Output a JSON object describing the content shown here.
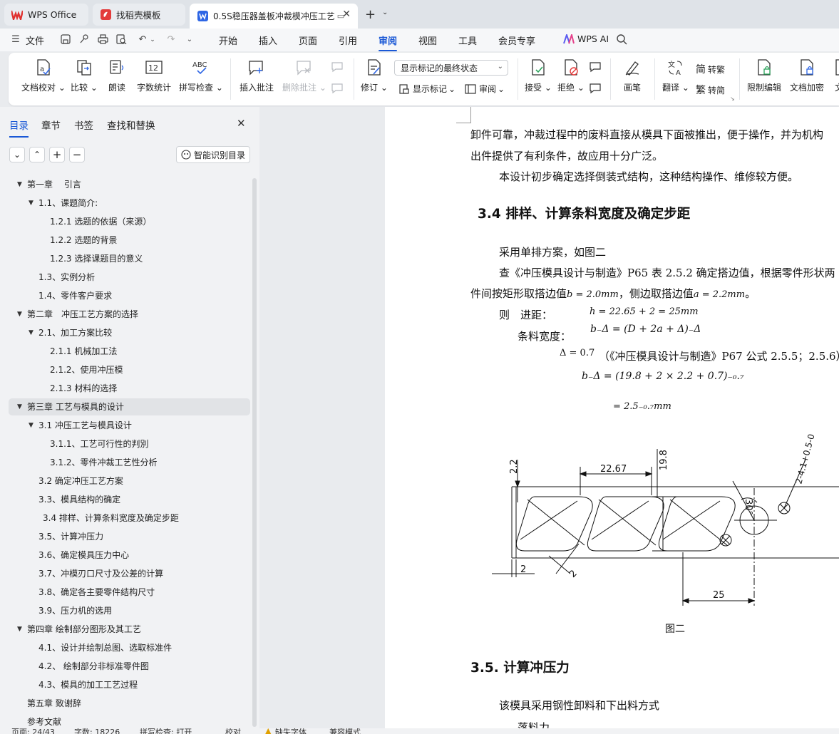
{
  "titlebar": {
    "tabs": [
      {
        "label": "WPS Office"
      },
      {
        "label": "找稻壳模板"
      },
      {
        "label": "0.5S稳压器盖板冲裁模冲压工艺"
      }
    ]
  },
  "menu": {
    "file": "文件",
    "items": [
      "开始",
      "插入",
      "页面",
      "引用",
      "审阅",
      "视图",
      "工具",
      "会员专享"
    ],
    "active": "审阅",
    "ai": "WPS AI"
  },
  "ribbon": {
    "doc_check": "文档校对",
    "compare": "比较",
    "read_aloud": "朗读",
    "word_count": "字数统计",
    "spell_check": "拼写检查",
    "insert_comment": "插入批注",
    "delete_comment": "删除批注",
    "revise": "修订",
    "markup_state": "显示标记的最终状态",
    "show_markup": "显示标记",
    "review": "审阅",
    "accept": "接受",
    "reject": "拒绝",
    "pen": "画笔",
    "translate": "翻译",
    "to_traditional": "转繁",
    "to_simplified": "转简",
    "restrict_edit": "限制编辑",
    "encrypt": "文档加密",
    "icon_text_abc": "ABC",
    "icon_text_12": "12"
  },
  "nav": {
    "tabs": [
      "目录",
      "章节",
      "书签",
      "查找和替换"
    ],
    "active_tab": "目录",
    "smart_btn": "智能识别目录",
    "toc": [
      {
        "text": "第一章　 引言",
        "level": 0,
        "arrow": true
      },
      {
        "text": "1.1、课题简介:",
        "level": 1,
        "arrow": true
      },
      {
        "text": "1.2.1 选题的依据（来源）",
        "level": 2,
        "arrow": false
      },
      {
        "text": "1.2.2 选题的背景",
        "level": 2,
        "arrow": false
      },
      {
        "text": "1.2.3 选择课题目的意义",
        "level": 2,
        "arrow": false
      },
      {
        "text": "1.3、实例分析",
        "level": 1,
        "arrow": false
      },
      {
        "text": "1.4、零件客户要求",
        "level": 1,
        "arrow": false
      },
      {
        "text": "第二章　冲压工艺方案的选择",
        "level": 0,
        "arrow": true
      },
      {
        "text": "2.1、加工方案比较",
        "level": 1,
        "arrow": true
      },
      {
        "text": "2.1.1 机械加工法",
        "level": 2,
        "arrow": false
      },
      {
        "text": "2.1.2、使用冲压模",
        "level": 2,
        "arrow": false
      },
      {
        "text": "2.1.3 材料的选择",
        "level": 2,
        "arrow": false
      },
      {
        "text": "第三章  工艺与模具的设计",
        "level": 0,
        "arrow": true,
        "selected": true
      },
      {
        "text": "3.1 冲压工艺与模具设计",
        "level": 1,
        "arrow": true
      },
      {
        "text": "3.1.1、工艺可行性的判別",
        "level": 2,
        "arrow": false
      },
      {
        "text": "3.1.2、零件冲裁工艺性分析",
        "level": 2,
        "arrow": false
      },
      {
        "text": "3.2 确定冲压工艺方案",
        "level": 1,
        "arrow": false
      },
      {
        "text": "3.3、模具结构的确定",
        "level": 1,
        "arrow": false
      },
      {
        "text": "3.4 排样、计算条料宽度及确定步距",
        "level": 1.4,
        "arrow": false
      },
      {
        "text": "3.5、计算冲压力",
        "level": 1,
        "arrow": false
      },
      {
        "text": "3.6、确定模具压力中心",
        "level": 1,
        "arrow": false
      },
      {
        "text": "3.7、冲模刃口尺寸及公差的计算",
        "level": 1,
        "arrow": false
      },
      {
        "text": "3.8、确定各主要零件结构尺寸",
        "level": 1,
        "arrow": false
      },
      {
        "text": "3.9、压力机的选用",
        "level": 1,
        "arrow": false
      },
      {
        "text": "第四章  绘制部分图形及其工艺",
        "level": 0,
        "arrow": true
      },
      {
        "text": "4.1、设计并绘制总图、选取标准件",
        "level": 1,
        "arrow": false
      },
      {
        "text": "4.2、  绘制部分非标准零件图",
        "level": 1,
        "arrow": false
      },
      {
        "text": "4.3、模具的加工工艺过程",
        "level": 1,
        "arrow": false
      },
      {
        "text": "第五章  致谢辞",
        "level": 0,
        "arrow": false
      },
      {
        "text": "参考文献",
        "level": 0,
        "arrow": false
      }
    ]
  },
  "doc": {
    "line1": "卸件可靠，冲裁过程中的废料直接从模具下面被推出，便于操作，并为机构",
    "line2": "出件提供了有利条件，故应用十分广泛。",
    "line3": "本设计初步确定选择倒装式结构，这种结构操作、维修较方便。",
    "heading34": "3.4 排样、计算条料宽度及确定步距",
    "line4": "采用单排方案，如图二",
    "line5": "查《冲压模具设计与制造》P65 表 2.5.2 确定搭边值，根据零件形状两",
    "line6a": "件间按矩形取搭边值",
    "line6b": "b = 2.0mm",
    "line6c": "，侧边取搭边值",
    "line6d": "a = 2.2mm",
    "line6e": "。",
    "ze": "则　进距：",
    "h_formula": "h = 22.65 + 2 = 25mm",
    "strip": "条料宽度：",
    "b_formula": "b₋Δ = (D + 2a + Δ)₋Δ",
    "delta": "Δ = 0.7",
    "delta_ref": "（《冲压模具设计与制造》P67 公式 2.5.5；2.5.6）",
    "b_calc": "b₋Δ = (19.8 + 2 × 2.2 + 0.7)₋₀.₇",
    "b_result": "= 2.5₋₀.₇mm",
    "fig_caption": "图二",
    "heading35": "3.5.  计算冲压力",
    "line7": "该模具采用钢性卸料和下出料方式",
    "line8": "落料力"
  },
  "drawing": {
    "dims": {
      "d22": "2.2",
      "d2267": "22.67",
      "d198": "19.8",
      "d30": "30°",
      "d2": "2",
      "d2b": "2",
      "d25": "25",
      "dtol": "2-4.1+0.5-0"
    }
  },
  "status": {
    "page": "页面: 24/43",
    "words": "字数: 18226",
    "spell": "拼写检查: 打开",
    "proof": "校对",
    "font_missing": "缺失字体",
    "compat": "兼容模式"
  }
}
